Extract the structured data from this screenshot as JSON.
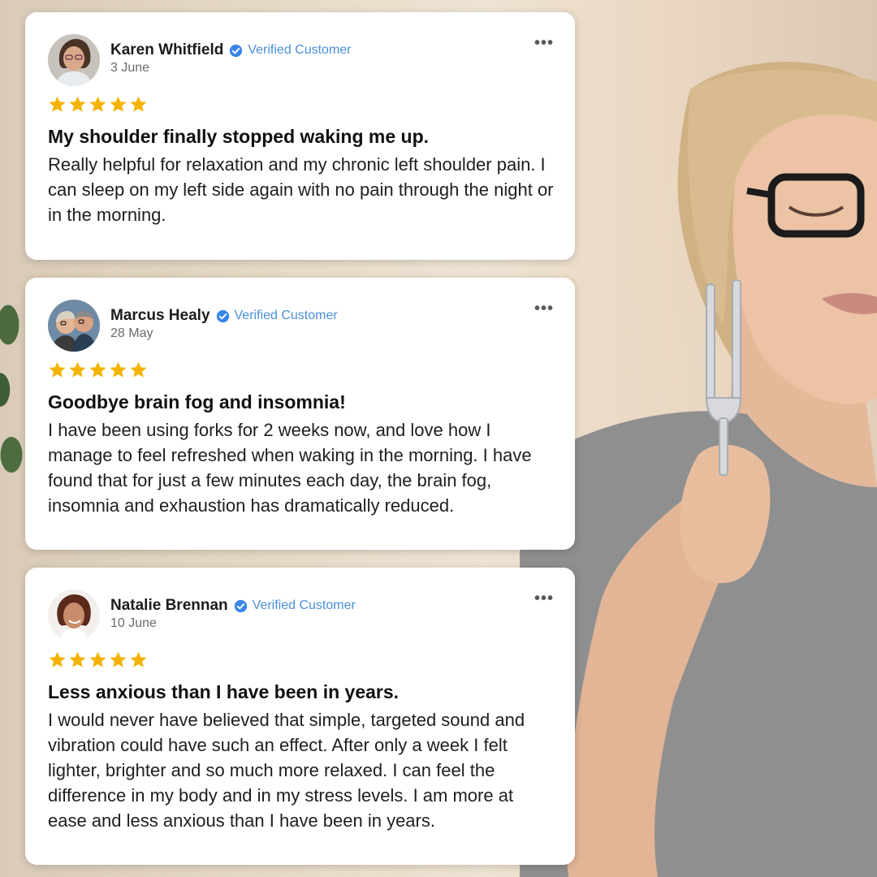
{
  "colors": {
    "star": "#f5b301",
    "verified": "#4a90d9",
    "card_bg": "#ffffff"
  },
  "icons": {
    "verified": "verified-check-icon",
    "star": "star-icon",
    "more": "more-options-icon"
  },
  "reviews": [
    {
      "name": "Karen Whitfield",
      "verified_label": "Verified Customer",
      "date": "3 June",
      "rating": 5,
      "title": "My shoulder finally stopped waking me up.",
      "body": "Really helpful for relaxation and my chronic left shoulder pain. I can sleep on my left side again with no pain through the night or in the morning."
    },
    {
      "name": "Marcus Healy",
      "verified_label": "Verified Customer",
      "date": "28 May",
      "rating": 5,
      "title": "Goodbye brain fog and insomnia!",
      "body": "I have been using forks for 2 weeks now, and love how I manage to feel refreshed when waking in the morning. I have found that for just a few minutes each day, the brain fog, insomnia and exhaustion has dramatically reduced."
    },
    {
      "name": "Natalie Brennan",
      "verified_label": "Verified Customer",
      "date": "10 June",
      "rating": 5,
      "title": "Less anxious than I have been in years.",
      "body": "I would never have believed that simple, targeted sound and vibration could have such an effect. After only a week I felt lighter, brighter and so much more relaxed. I can feel the difference in my body and in my stress levels. I am more at ease and less anxious than I have been in years."
    }
  ]
}
